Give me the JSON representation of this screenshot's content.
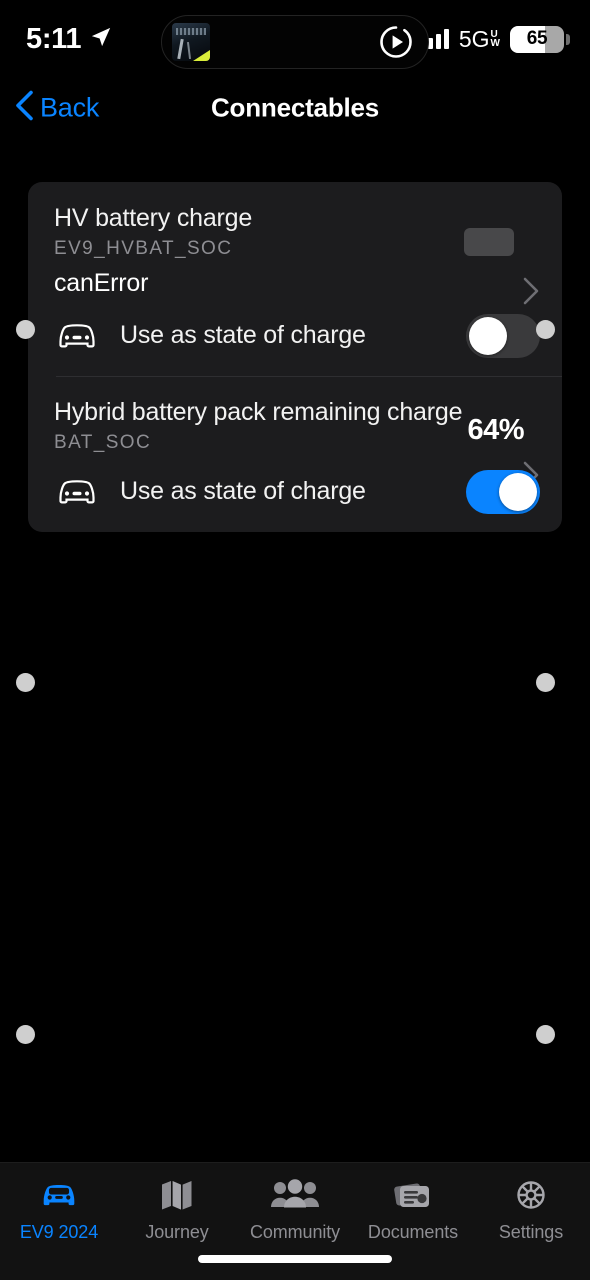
{
  "status_bar": {
    "time": "5:11",
    "location_icon": "location-arrow-icon",
    "signal_icon": "cellular-bars-icon",
    "network": "5G",
    "network_sup_top": "U",
    "network_sup_bottom": "W",
    "battery_percent": "65",
    "battery_level": 65
  },
  "dynamic_island": {
    "artwork_label": "now-playing-artwork",
    "play_icon": "play-circle-icon"
  },
  "navbar": {
    "back_label": "Back",
    "back_icon": "chevron-left-icon",
    "title": "Connectables",
    "accent_color": "#0A84FF"
  },
  "card": {
    "rows": [
      {
        "title": "HV battery charge",
        "subtitle": "EV9_HVBAT_SOC",
        "value": "canError",
        "badge": "loading-placeholder",
        "chevron_icon": "chevron-right-icon",
        "toggle": {
          "icon": "car-front-icon",
          "label": "Use as state of charge",
          "state": "off"
        }
      },
      {
        "title": "Hybrid battery pack remaining charge",
        "subtitle": "BAT_SOC",
        "value": "64%",
        "chevron_icon": "chevron-right-icon",
        "toggle": {
          "icon": "car-front-icon",
          "label": "Use as state of charge",
          "state": "on"
        }
      }
    ]
  },
  "touch_indicators": {
    "name": "touch-point-dot",
    "count": 6
  },
  "tabbar": {
    "items": [
      {
        "label": "EV9 2024",
        "icon": "car-icon",
        "active": true
      },
      {
        "label": "Journey",
        "icon": "map-icon",
        "active": false
      },
      {
        "label": "Community",
        "icon": "people-icon",
        "active": false
      },
      {
        "label": "Documents",
        "icon": "documents-icon",
        "active": false
      },
      {
        "label": "Settings",
        "icon": "gear-icon",
        "active": false
      }
    ],
    "active_color": "#0A84FF",
    "inactive_color": "#8E8E93"
  },
  "home_indicator": "home-indicator-bar"
}
